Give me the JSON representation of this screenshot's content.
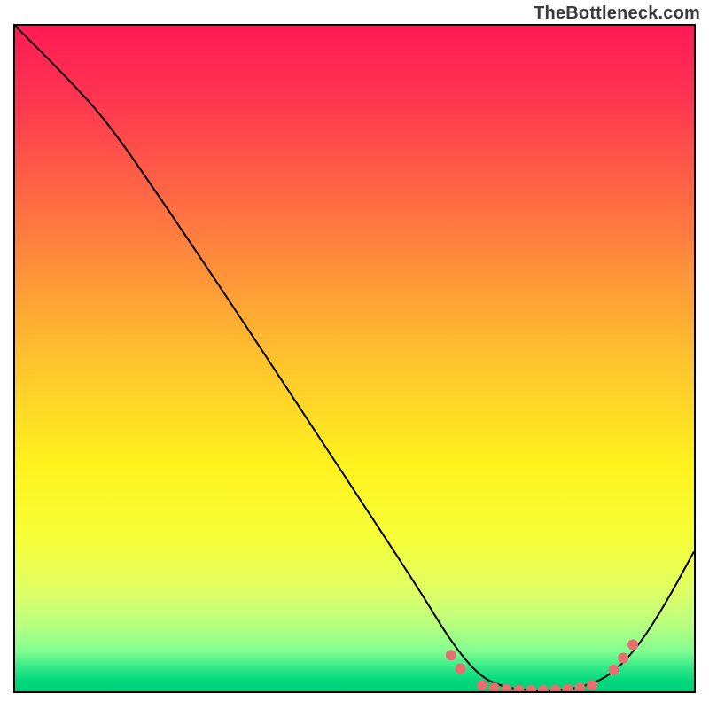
{
  "watermark": "TheBottleneck.com",
  "chart_data": {
    "type": "line",
    "title": "",
    "xlabel": "",
    "ylabel": "",
    "xlim": [
      0,
      100
    ],
    "ylim": [
      0,
      100
    ],
    "gradient_stops": [
      {
        "offset": 0.0,
        "color": "#ff1a55"
      },
      {
        "offset": 0.12,
        "color": "#ff3850"
      },
      {
        "offset": 0.3,
        "color": "#ff7840"
      },
      {
        "offset": 0.5,
        "color": "#ffc22e"
      },
      {
        "offset": 0.66,
        "color": "#fff21e"
      },
      {
        "offset": 0.77,
        "color": "#f6ff38"
      },
      {
        "offset": 0.85,
        "color": "#e0ff66"
      },
      {
        "offset": 0.9,
        "color": "#b8ff80"
      },
      {
        "offset": 0.94,
        "color": "#80ff90"
      },
      {
        "offset": 0.965,
        "color": "#30e888"
      },
      {
        "offset": 0.985,
        "color": "#00d87d"
      },
      {
        "offset": 1.0,
        "color": "#00d07a"
      }
    ],
    "curve_points": [
      {
        "x": 0.0,
        "y": 100.0
      },
      {
        "x": 8.5,
        "y": 91.3
      },
      {
        "x": 14.0,
        "y": 85.0
      },
      {
        "x": 22.0,
        "y": 73.2
      },
      {
        "x": 32.0,
        "y": 58.0
      },
      {
        "x": 42.0,
        "y": 42.5
      },
      {
        "x": 52.0,
        "y": 27.0
      },
      {
        "x": 60.0,
        "y": 14.5
      },
      {
        "x": 64.5,
        "y": 7.0
      },
      {
        "x": 68.5,
        "y": 2.2
      },
      {
        "x": 72.0,
        "y": 0.6
      },
      {
        "x": 76.0,
        "y": 0.1
      },
      {
        "x": 80.0,
        "y": 0.1
      },
      {
        "x": 84.0,
        "y": 0.7
      },
      {
        "x": 88.0,
        "y": 2.6
      },
      {
        "x": 92.0,
        "y": 7.0
      },
      {
        "x": 96.0,
        "y": 13.5
      },
      {
        "x": 100.0,
        "y": 21.0
      }
    ],
    "dots": [
      {
        "x": 64.2,
        "y": 5.4
      },
      {
        "x": 65.6,
        "y": 3.4
      },
      {
        "x": 68.8,
        "y": 0.9
      },
      {
        "x": 70.6,
        "y": 0.5
      },
      {
        "x": 72.4,
        "y": 0.3
      },
      {
        "x": 74.2,
        "y": 0.2
      },
      {
        "x": 76.0,
        "y": 0.15
      },
      {
        "x": 77.8,
        "y": 0.15
      },
      {
        "x": 79.6,
        "y": 0.2
      },
      {
        "x": 81.4,
        "y": 0.3
      },
      {
        "x": 83.2,
        "y": 0.5
      },
      {
        "x": 85.0,
        "y": 0.9
      },
      {
        "x": 88.2,
        "y": 3.2
      },
      {
        "x": 89.6,
        "y": 5.0
      },
      {
        "x": 91.0,
        "y": 7.0
      }
    ],
    "dot_radius_px": 6
  }
}
